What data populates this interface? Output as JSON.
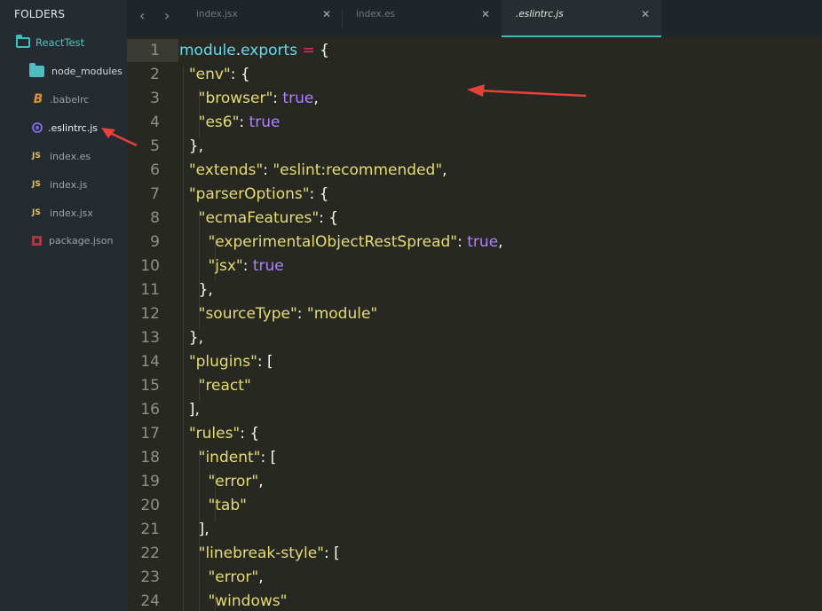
{
  "sidebar": {
    "title": "FOLDERS",
    "root": "ReactTest",
    "items": [
      {
        "label": "node_modules",
        "icon": "folder-icon"
      },
      {
        "label": ".babelrc",
        "icon": "babel-icon"
      },
      {
        "label": ".eslintrc.js",
        "icon": "eslint-icon"
      },
      {
        "label": "index.es",
        "icon": "js-icon"
      },
      {
        "label": "index.js",
        "icon": "js-icon"
      },
      {
        "label": "index.jsx",
        "icon": "js-icon"
      },
      {
        "label": "package.json",
        "icon": "package-icon"
      }
    ]
  },
  "tabs": [
    {
      "label": "index.jsx",
      "active": false
    },
    {
      "label": "index.es",
      "active": false
    },
    {
      "label": ".eslintrc.js",
      "active": true
    }
  ],
  "nav": {
    "back": "‹",
    "forward": "›",
    "close": "✕"
  },
  "colors": {
    "accent": "#3fb7b2",
    "keyword": "#66d9ef",
    "string": "#e6db74",
    "boolean": "#ae81ff",
    "operator": "#f92672",
    "annotation_arrow": "#e8413a"
  },
  "editor": {
    "line_numbers": [
      "1",
      "2",
      "3",
      "4",
      "5",
      "6",
      "7",
      "8",
      "9",
      "10",
      "11",
      "12",
      "13",
      "14",
      "15",
      "16",
      "17",
      "18",
      "19",
      "20",
      "21",
      "22",
      "23",
      "24"
    ],
    "lines": [
      [
        {
          "t": "module",
          "c": "k"
        },
        {
          "t": ".",
          "c": "p"
        },
        {
          "t": "exports",
          "c": "k"
        },
        {
          "t": " ",
          "c": "p"
        },
        {
          "t": "=",
          "c": "o"
        },
        {
          "t": " {",
          "c": "p"
        }
      ],
      [
        {
          "t": "  ",
          "c": "p"
        },
        {
          "t": "\"env\"",
          "c": "s"
        },
        {
          "t": ": {",
          "c": "p"
        }
      ],
      [
        {
          "t": "    ",
          "c": "p"
        },
        {
          "t": "\"browser\"",
          "c": "s"
        },
        {
          "t": ": ",
          "c": "p"
        },
        {
          "t": "true",
          "c": "b"
        },
        {
          "t": ",",
          "c": "p"
        }
      ],
      [
        {
          "t": "    ",
          "c": "p"
        },
        {
          "t": "\"es6\"",
          "c": "s"
        },
        {
          "t": ": ",
          "c": "p"
        },
        {
          "t": "true",
          "c": "b"
        }
      ],
      [
        {
          "t": "  },",
          "c": "p"
        }
      ],
      [
        {
          "t": "  ",
          "c": "p"
        },
        {
          "t": "\"extends\"",
          "c": "s"
        },
        {
          "t": ": ",
          "c": "p"
        },
        {
          "t": "\"eslint:recommended\"",
          "c": "s"
        },
        {
          "t": ",",
          "c": "p"
        }
      ],
      [
        {
          "t": "  ",
          "c": "p"
        },
        {
          "t": "\"parserOptions\"",
          "c": "s"
        },
        {
          "t": ": {",
          "c": "p"
        }
      ],
      [
        {
          "t": "    ",
          "c": "p"
        },
        {
          "t": "\"ecmaFeatures\"",
          "c": "s"
        },
        {
          "t": ": {",
          "c": "p"
        }
      ],
      [
        {
          "t": "      ",
          "c": "p"
        },
        {
          "t": "\"experimentalObjectRestSpread\"",
          "c": "s"
        },
        {
          "t": ": ",
          "c": "p"
        },
        {
          "t": "true",
          "c": "b"
        },
        {
          "t": ",",
          "c": "p"
        }
      ],
      [
        {
          "t": "      ",
          "c": "p"
        },
        {
          "t": "\"jsx\"",
          "c": "s"
        },
        {
          "t": ": ",
          "c": "p"
        },
        {
          "t": "true",
          "c": "b"
        }
      ],
      [
        {
          "t": "    },",
          "c": "p"
        }
      ],
      [
        {
          "t": "    ",
          "c": "p"
        },
        {
          "t": "\"sourceType\"",
          "c": "s"
        },
        {
          "t": ": ",
          "c": "p"
        },
        {
          "t": "\"module\"",
          "c": "s"
        }
      ],
      [
        {
          "t": "  },",
          "c": "p"
        }
      ],
      [
        {
          "t": "  ",
          "c": "p"
        },
        {
          "t": "\"plugins\"",
          "c": "s"
        },
        {
          "t": ": [",
          "c": "p"
        }
      ],
      [
        {
          "t": "    ",
          "c": "p"
        },
        {
          "t": "\"react\"",
          "c": "s"
        }
      ],
      [
        {
          "t": "  ],",
          "c": "p"
        }
      ],
      [
        {
          "t": "  ",
          "c": "p"
        },
        {
          "t": "\"rules\"",
          "c": "s"
        },
        {
          "t": ": {",
          "c": "p"
        }
      ],
      [
        {
          "t": "    ",
          "c": "p"
        },
        {
          "t": "\"indent\"",
          "c": "s"
        },
        {
          "t": ": [",
          "c": "p"
        }
      ],
      [
        {
          "t": "      ",
          "c": "p"
        },
        {
          "t": "\"error\"",
          "c": "s"
        },
        {
          "t": ",",
          "c": "p"
        }
      ],
      [
        {
          "t": "      ",
          "c": "p"
        },
        {
          "t": "\"tab\"",
          "c": "s"
        }
      ],
      [
        {
          "t": "    ],",
          "c": "p"
        }
      ],
      [
        {
          "t": "    ",
          "c": "p"
        },
        {
          "t": "\"linebreak-style\"",
          "c": "s"
        },
        {
          "t": ": [",
          "c": "p"
        }
      ],
      [
        {
          "t": "      ",
          "c": "p"
        },
        {
          "t": "\"error\"",
          "c": "s"
        },
        {
          "t": ",",
          "c": "p"
        }
      ],
      [
        {
          "t": "      ",
          "c": "p"
        },
        {
          "t": "\"windows\"",
          "c": "s"
        }
      ]
    ]
  }
}
